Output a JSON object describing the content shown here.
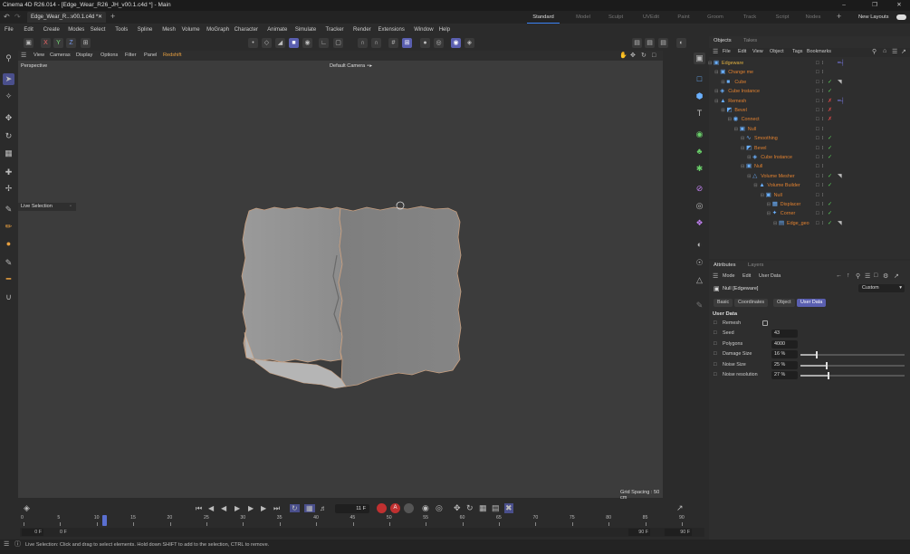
{
  "window": {
    "title": "Cinema 4D R26.014 - [Edge_Wear_R26_JH_v00.1.c4d *] - Main"
  },
  "tabs": {
    "doc_tab": "Edge_Wear_R...v00.1.c4d *",
    "layouts": [
      "Standard",
      "Model",
      "Sculpt",
      "UVEdit",
      "Paint",
      "Groom",
      "Track",
      "Script",
      "Nodes"
    ],
    "new_layouts": "New Layouts"
  },
  "menu": [
    "File",
    "Edit",
    "Create",
    "Modes",
    "Select",
    "Tools",
    "Spline",
    "Mesh",
    "Volume",
    "MoGraph",
    "Character",
    "Animate",
    "Simulate",
    "Tracker",
    "Render",
    "Extensions",
    "Window",
    "Help"
  ],
  "toolbar": {
    "axis": [
      "X",
      "Y",
      "Z"
    ]
  },
  "viewport": {
    "menu": [
      "View",
      "Cameras",
      "Display",
      "Options",
      "Filter",
      "Panel",
      "Redshift"
    ],
    "projection": "Perspective",
    "camera": "Default Camera ∘▸",
    "tool_label": "Live Selection",
    "grid_spacing": "Grid Spacing : 50 cm"
  },
  "timeline": {
    "current_frame": "11 F",
    "ticks": [
      "0",
      "5",
      "10",
      "15",
      "20",
      "25",
      "30",
      "35",
      "40",
      "45",
      "50",
      "55",
      "60",
      "65",
      "70",
      "75",
      "80",
      "85",
      "90"
    ],
    "start_a": "0 F",
    "start_b": "0 F",
    "end_a": "90 F",
    "end_b": "90 F"
  },
  "status": {
    "message": "Live Selection: Click and drag to select elements. Hold down SHIFT to add to the selection, CTRL to remove."
  },
  "objects_panel": {
    "tabs": [
      "Objects",
      "Takes"
    ],
    "menu": [
      "File",
      "Edit",
      "View",
      "Object",
      "Tags",
      "Bookmarks"
    ],
    "items": [
      {
        "name": "Edgeware",
        "depth": 0,
        "color": "#e0b040",
        "icon": "null-icon",
        "check": "",
        "tag": "rig-tag-icon"
      },
      {
        "name": "Change me",
        "depth": 1,
        "color": "#e08030",
        "icon": "null-icon",
        "check": "",
        "tag": ""
      },
      {
        "name": "Cube",
        "depth": 2,
        "color": "#e08030",
        "icon": "cube-icon",
        "check": "✓",
        "tag": "material-tag-icon"
      },
      {
        "name": "Cube Instance",
        "depth": 1,
        "color": "#e08030",
        "icon": "instance-icon",
        "check": "✓",
        "tag": ""
      },
      {
        "name": "Remesh",
        "depth": 1,
        "color": "#e08030",
        "icon": "remesh-icon",
        "check": "✗",
        "tag": "rig-tag-icon"
      },
      {
        "name": "Bevel",
        "depth": 2,
        "color": "#e08030",
        "icon": "bevel-icon",
        "check": "✗",
        "tag": ""
      },
      {
        "name": "Connect",
        "depth": 3,
        "color": "#e08030",
        "icon": "connect-icon",
        "check": "✗",
        "tag": ""
      },
      {
        "name": "Null",
        "depth": 4,
        "color": "#e08030",
        "icon": "null-icon",
        "check": "",
        "tag": ""
      },
      {
        "name": "Smoothing",
        "depth": 5,
        "color": "#e08030",
        "icon": "smoothing-icon",
        "check": "✓",
        "tag": ""
      },
      {
        "name": "Bevel",
        "depth": 5,
        "color": "#e08030",
        "icon": "bevel-icon",
        "check": "✓",
        "tag": ""
      },
      {
        "name": "Cube Instance",
        "depth": 6,
        "color": "#e08030",
        "icon": "instance-icon",
        "check": "✓",
        "tag": ""
      },
      {
        "name": "Null",
        "depth": 5,
        "color": "#e08030",
        "icon": "null-icon",
        "check": "",
        "tag": ""
      },
      {
        "name": "Volume Mesher",
        "depth": 6,
        "color": "#e08030",
        "icon": "volume-mesher-icon",
        "check": "✓",
        "tag": "material-tag-icon"
      },
      {
        "name": "Volume Builder",
        "depth": 7,
        "color": "#e08030",
        "icon": "volume-builder-icon",
        "check": "✓",
        "tag": ""
      },
      {
        "name": "Null",
        "depth": 8,
        "color": "#e08030",
        "icon": "null-icon",
        "check": "",
        "tag": ""
      },
      {
        "name": "Displacer",
        "depth": 9,
        "color": "#e08030",
        "icon": "displacer-icon",
        "check": "✓",
        "tag": ""
      },
      {
        "name": "Corner",
        "depth": 9,
        "color": "#e08030",
        "icon": "corner-icon",
        "check": "✓",
        "tag": ""
      },
      {
        "name": "Edge_geo",
        "depth": 10,
        "color": "#e08030",
        "icon": "polygon-icon",
        "check": "✓",
        "tag": "material-tag-icon"
      }
    ]
  },
  "attributes_panel": {
    "tabs": [
      "Attributes",
      "Layers"
    ],
    "menu": [
      "Mode",
      "Edit",
      "User Data"
    ],
    "object_label": "Null [Edgeware]",
    "preset": "Custom",
    "sub_tabs": [
      "Basic",
      "Coordinates",
      "Object",
      "User Data"
    ],
    "section": "User Data",
    "fields": [
      {
        "label": "Remesh",
        "type": "checkbox",
        "value": ""
      },
      {
        "label": "Seed",
        "type": "number",
        "value": "43"
      },
      {
        "label": "Polygons",
        "type": "number",
        "value": "4000"
      },
      {
        "label": "Damage Size",
        "type": "slider",
        "value": "16 %",
        "level": 0.16
      },
      {
        "label": "Noise Size",
        "type": "slider",
        "value": "25 %",
        "level": 0.25
      },
      {
        "label": "Noise resolution",
        "type": "slider",
        "value": "27 %",
        "level": 0.27
      }
    ]
  }
}
